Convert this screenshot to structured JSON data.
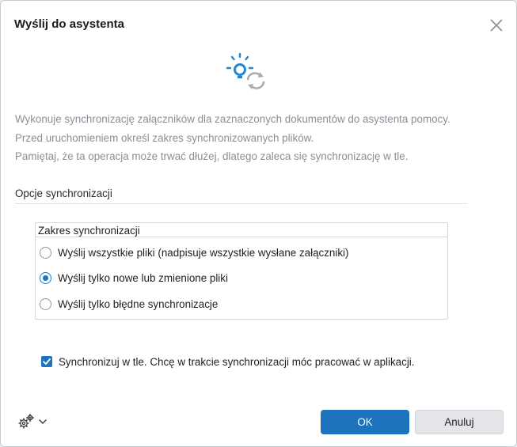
{
  "dialog": {
    "title": "Wyślij do asystenta",
    "description": [
      "Wykonuje synchronizację załączników dla zaznaczonych dokumentów do asystenta pomocy.",
      "Przed uruchomieniem określ zakres synchronizowanych plików.",
      "Pamiętaj, że ta operacja może trwać dłużej, dlatego zaleca się synchronizację w tle."
    ],
    "section_title": "Opcje synchronizacji",
    "group": {
      "legend": "Zakres synchronizacji",
      "options": [
        {
          "label": "Wyślij wszystkie pliki (nadpisuje wszystkie wysłane załączniki)",
          "selected": false
        },
        {
          "label": "Wyślij tylko nowe lub zmienione pliki",
          "selected": true
        },
        {
          "label": "Wyślij tylko błędne synchronizacje",
          "selected": false
        }
      ]
    },
    "background_sync": {
      "label": "Synchronizuj w tle. Chcę w trakcie synchronizacji móc pracować w aplikacji.",
      "checked": true
    },
    "buttons": {
      "ok": "OK",
      "cancel": "Anuluj"
    },
    "icons": {
      "close": "close-icon",
      "hero": "sync-bulb-icon",
      "settings": "gears-icon",
      "settings_menu": "chevron-down-icon"
    },
    "colors": {
      "accent": "#1e73be",
      "muted_text": "#8a8f96"
    }
  }
}
